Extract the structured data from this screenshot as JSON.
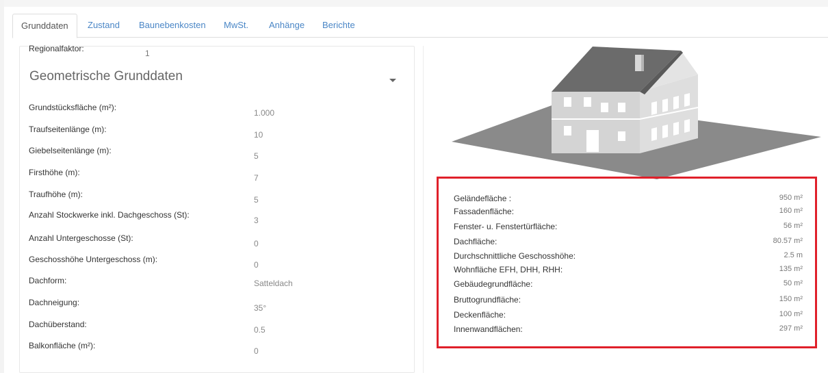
{
  "tabs": [
    {
      "label": "Grunddaten",
      "active": true
    },
    {
      "label": "Zustand",
      "active": false
    },
    {
      "label": "Baunebenkosten",
      "active": false
    },
    {
      "label": "MwSt.",
      "active": false
    },
    {
      "label": "Anhänge",
      "active": false
    },
    {
      "label": "Berichte",
      "active": false
    }
  ],
  "regional": {
    "label": "Regionalfaktor:",
    "value": "1"
  },
  "section": {
    "title": "Geometrische Grunddaten",
    "toggle_icon": "caret-down-icon"
  },
  "fields": [
    {
      "label": "Grundstücksfläche (m²):",
      "value": "1.000"
    },
    {
      "label": "Traufseitenlänge (m):",
      "value": "10"
    },
    {
      "label": "Giebelseitenlänge (m):",
      "value": "5"
    },
    {
      "label": "Firsthöhe (m):",
      "value": "7"
    },
    {
      "label": "Traufhöhe (m):",
      "value": "5"
    },
    {
      "label": "Anzahl Stockwerke inkl. Dachgeschoss (St):",
      "value": "3"
    },
    {
      "label": "Anzahl Untergeschosse (St):",
      "value": "0"
    },
    {
      "label": "Geschosshöhe Untergeschoss (m):",
      "value": "0"
    },
    {
      "label": "Dachform:",
      "value": "Satteldach"
    },
    {
      "label": "Dachneigung:",
      "value": "35°"
    },
    {
      "label": "Dachüberstand:",
      "value": "0.5"
    },
    {
      "label": "Balkonfläche (m²):",
      "value": "0"
    }
  ],
  "results": [
    {
      "label": "Geländefläche :",
      "value": "950 m²"
    },
    {
      "label": "Fassadenfläche:",
      "value": "160 m²"
    },
    {
      "label": "Fenster- u. Fenstertürfläche:",
      "value": "56 m²"
    },
    {
      "label": "Dachfläche:",
      "value": "80.57 m²"
    },
    {
      "label": "Durchschnittliche Geschosshöhe:",
      "value": "2.5 m"
    },
    {
      "label": "Wohnfläche EFH, DHH, RHH:",
      "value": "135 m²"
    },
    {
      "label": "Gebäudegrundfläche:",
      "value": "50 m²"
    },
    {
      "label": "Bruttogrundfläche:",
      "value": "150 m²"
    },
    {
      "label": "Deckenfläche:",
      "value": "100 m²"
    },
    {
      "label": "Innenwandflächen:",
      "value": "297 m²"
    }
  ],
  "colors": {
    "accent": "#4a86c6",
    "highlight_border": "#e0202a"
  },
  "illustration": {
    "icon": "house-3d-icon"
  }
}
